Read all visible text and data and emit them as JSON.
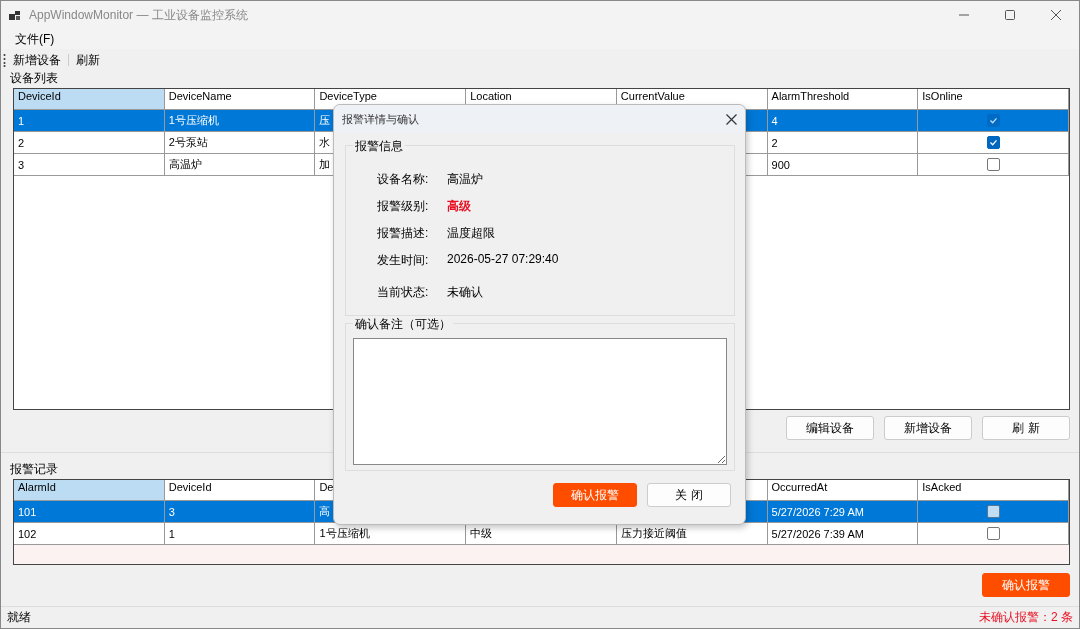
{
  "window": {
    "title": "AppWindowMonitor — 工业设备监控系统"
  },
  "menu": [
    "文件(F)"
  ],
  "toolbar": [
    "新增设备",
    "刷新"
  ],
  "device_section": {
    "title": "设备列表",
    "columns": {
      "device_id": "DeviceId",
      "device_name": "DeviceName",
      "device_type": "DeviceType",
      "location": "Location",
      "current_value": "CurrentValue",
      "alarm_threshold": "AlarmThreshold",
      "is_online": "IsOnline"
    },
    "rows": [
      {
        "device_id": "1",
        "device_name": "1号压缩机",
        "device_type": "压",
        "alarm_threshold": "4",
        "is_online": true,
        "selected": true
      },
      {
        "device_id": "2",
        "device_name": "2号泵站",
        "device_type": "水",
        "alarm_threshold": "2",
        "is_online": true,
        "selected": false
      },
      {
        "device_id": "3",
        "device_name": "高温炉",
        "device_type": "加",
        "alarm_threshold": "900",
        "is_online": false,
        "selected": false
      }
    ],
    "buttons": [
      "编辑设备",
      "新增设备",
      "刷 新"
    ]
  },
  "alarm_section": {
    "title": "报警记录",
    "columns": {
      "alarm_id": "AlarmId",
      "device_id": "DeviceId",
      "device_name": "De",
      "occurred_at": "OccurredAt",
      "is_acked": "IsAcked"
    },
    "rows": [
      {
        "alarm_id": "101",
        "device_id": "3",
        "device_name": "高",
        "occurred_at": "5/27/2026 7:29 AM",
        "is_acked": false,
        "selected": true
      },
      {
        "alarm_id": "102",
        "device_id": "1",
        "device_name": "1号压缩机",
        "column_4": "中级",
        "column_5": "压力接近阈值",
        "occurred_at": "5/27/2026 7:39 AM",
        "is_acked": false,
        "selected": false
      }
    ],
    "button": "确认报警"
  },
  "status_bar": {
    "status": "就绪",
    "unacked": "未确认报警：2 条"
  },
  "dialog": {
    "title": "报警详情与确认",
    "info_title": "报警信息",
    "fields": [
      {
        "label": "设备名称:",
        "value": "高温炉",
        "kind": "text"
      },
      {
        "label": "报警级别:",
        "value": "高级",
        "kind": "alert"
      },
      {
        "label": "报警描述:",
        "value": "温度超限",
        "kind": "text"
      },
      {
        "label": "发生时间:",
        "value": "2026-05-27 07:29:40",
        "kind": "text"
      },
      {
        "label": "当前状态:",
        "value": "未确认",
        "kind": "text"
      }
    ],
    "note_title": "确认备注（可选）",
    "buttons": [
      {
        "label": "确认报警",
        "kind": "primary"
      },
      {
        "label": "关 闭",
        "kind": "normal"
      }
    ]
  }
}
